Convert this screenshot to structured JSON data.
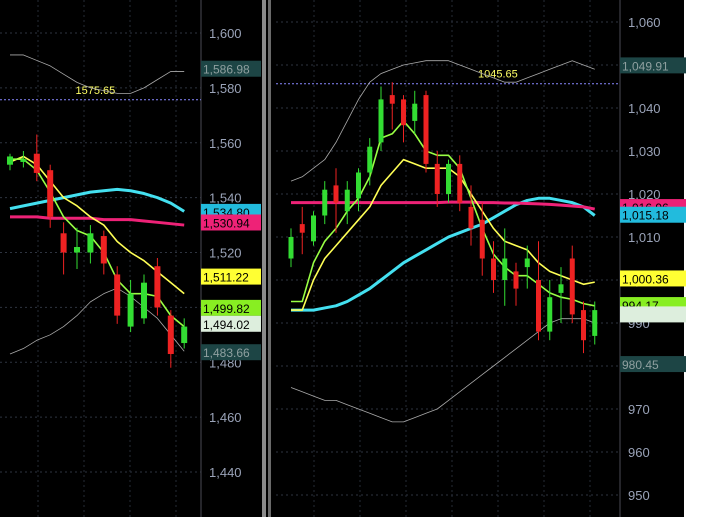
{
  "chart_data": [
    {
      "type": "candlestick",
      "panel": "left",
      "ylim": [
        1430,
        1615
      ],
      "yticks": [
        {
          "value": 1600,
          "label": "1,600"
        },
        {
          "value": 1580,
          "label": "1,580"
        },
        {
          "value": 1560,
          "label": "1,560"
        },
        {
          "value": 1540,
          "label": "1,540"
        },
        {
          "value": 1520,
          "label": "1,520"
        },
        {
          "value": 1500,
          "label": "1,500"
        },
        {
          "value": 1480,
          "label": "1,480"
        },
        {
          "value": 1460,
          "label": "1,460"
        },
        {
          "value": 1440,
          "label": "1,440"
        }
      ],
      "reference_line": {
        "value": 1575.65,
        "label": "1575.65"
      },
      "candles": [
        {
          "o": 1552,
          "h": 1556,
          "c": 1555,
          "l": 1550
        },
        {
          "o": 1553,
          "h": 1557,
          "c": 1554,
          "l": 1551
        },
        {
          "o": 1556,
          "h": 1563,
          "c": 1549,
          "l": 1546
        },
        {
          "o": 1550,
          "h": 1552,
          "c": 1533,
          "l": 1529
        },
        {
          "o": 1527,
          "h": 1531,
          "c": 1520,
          "l": 1512
        },
        {
          "o": 1520,
          "h": 1529,
          "c": 1522,
          "l": 1514
        },
        {
          "o": 1520,
          "h": 1530,
          "c": 1527,
          "l": 1516
        },
        {
          "o": 1526,
          "h": 1528,
          "c": 1516,
          "l": 1512
        },
        {
          "o": 1512,
          "h": 1515,
          "c": 1497,
          "l": 1494
        },
        {
          "o": 1493,
          "h": 1510,
          "c": 1505,
          "l": 1491
        },
        {
          "o": 1496,
          "h": 1512,
          "c": 1509,
          "l": 1494
        },
        {
          "o": 1515,
          "h": 1518,
          "c": 1500,
          "l": 1497
        },
        {
          "o": 1497,
          "h": 1499,
          "c": 1483,
          "l": 1478
        },
        {
          "o": 1487,
          "h": 1496,
          "c": 1493,
          "l": 1485
        }
      ],
      "series": [
        {
          "name": "",
          "color": "#44e0f0",
          "values": [
            1536,
            1537,
            1538,
            1539,
            1540,
            1541,
            1542,
            1542.5,
            1543,
            1542.5,
            1541.5,
            1540,
            1538,
            1535
          ]
        },
        {
          "name": "",
          "color": "#ee2277",
          "values": [
            1533,
            1533,
            1533,
            1532.5,
            1532.5,
            1532.5,
            1532.5,
            1532,
            1532,
            1532,
            1531.5,
            1531,
            1530.5,
            1530
          ]
        },
        {
          "name": "",
          "color": "#ffff55",
          "values": [
            1553,
            1555,
            1552,
            1546,
            1540,
            1537,
            1533,
            1530,
            1524,
            1520,
            1517,
            1513,
            1509,
            1505
          ]
        },
        {
          "name": "",
          "color": "#99ff44",
          "values": [
            1554,
            1554,
            1550,
            1542,
            1533,
            1528,
            1526,
            1520,
            1510,
            1505,
            1505,
            1504,
            1497,
            1493
          ]
        },
        {
          "name": "",
          "color": "#aaaaaa",
          "values": [
            1483,
            1485,
            1488,
            1490,
            1493,
            1497,
            1502,
            1505,
            1507,
            1504,
            1500,
            1496,
            1490,
            1484
          ]
        },
        {
          "name": "",
          "color": "#aaaaaa",
          "values": [
            1592,
            1592,
            1590,
            1588,
            1585,
            1582,
            1580,
            1579,
            1578,
            1578,
            1580,
            1583,
            1586,
            1586
          ]
        }
      ],
      "price_labels": [
        {
          "value": 1586.98,
          "label": "1,586.98",
          "bg": "#1d4545",
          "fg": "#8fa0a0"
        },
        {
          "value": 1534.8,
          "label": "1,534.80",
          "bg": "#22bbdd",
          "fg": "#000000"
        },
        {
          "value": 1530.94,
          "label": "1,530.94",
          "bg": "#ee2277",
          "fg": "#000000"
        },
        {
          "value": 1511.22,
          "label": "1,511.22",
          "bg": "#ffff33",
          "fg": "#000000"
        },
        {
          "value": 1499.82,
          "label": "1,499.82",
          "bg": "#88ee22",
          "fg": "#000000"
        },
        {
          "value": 1494.02,
          "label": "1,494.02",
          "bg": "#ddeedd",
          "fg": "#000000"
        },
        {
          "value": 1483.66,
          "label": "1,483.66",
          "bg": "#1d4545",
          "fg": "#8fa0a0"
        }
      ]
    },
    {
      "type": "candlestick",
      "panel": "right",
      "ylim": [
        945,
        1063
      ],
      "yticks": [
        {
          "value": 1060,
          "label": "1,060"
        },
        {
          "value": 1050,
          "label": "1,050"
        },
        {
          "value": 1040,
          "label": "1,040"
        },
        {
          "value": 1030,
          "label": "1,030"
        },
        {
          "value": 1020,
          "label": "1,020"
        },
        {
          "value": 1010,
          "label": "1,010"
        },
        {
          "value": 1000,
          "label": "1,000"
        },
        {
          "value": 990,
          "label": "990"
        },
        {
          "value": 980,
          "label": "980"
        },
        {
          "value": 970,
          "label": "970"
        },
        {
          "value": 960,
          "label": "960"
        },
        {
          "value": 950,
          "label": "950"
        }
      ],
      "reference_line": {
        "value": 1045.65,
        "label": "1045.65"
      },
      "candles": [
        {
          "o": 1005,
          "h": 1012,
          "c": 1010,
          "l": 1003
        },
        {
          "o": 1013,
          "h": 1017,
          "c": 1011,
          "l": 1006
        },
        {
          "o": 1009,
          "h": 1016,
          "c": 1015,
          "l": 1008
        },
        {
          "o": 1015,
          "h": 1023,
          "c": 1021,
          "l": 1013
        },
        {
          "o": 1022,
          "h": 1026,
          "c": 1018,
          "l": 1011
        },
        {
          "o": 1016,
          "h": 1023,
          "c": 1021,
          "l": 1013
        },
        {
          "o": 1019,
          "h": 1026,
          "c": 1025,
          "l": 1016
        },
        {
          "o": 1025,
          "h": 1033,
          "c": 1031,
          "l": 1022
        },
        {
          "o": 1032,
          "h": 1045,
          "c": 1042,
          "l": 1030
        },
        {
          "o": 1043,
          "h": 1046,
          "c": 1041,
          "l": 1035
        },
        {
          "o": 1042,
          "h": 1043,
          "c": 1036,
          "l": 1032
        },
        {
          "o": 1037,
          "h": 1044,
          "c": 1041,
          "l": 1034
        },
        {
          "o": 1043,
          "h": 1044,
          "c": 1027,
          "l": 1025
        },
        {
          "o": 1027,
          "h": 1030,
          "c": 1020,
          "l": 1017
        },
        {
          "o": 1020,
          "h": 1028,
          "c": 1027,
          "l": 1018
        },
        {
          "o": 1027,
          "h": 1029,
          "c": 1018,
          "l": 1016
        },
        {
          "o": 1017,
          "h": 1022,
          "c": 1012,
          "l": 1008
        },
        {
          "o": 1014,
          "h": 1018,
          "c": 1005,
          "l": 1001
        },
        {
          "o": 1005,
          "h": 1009,
          "c": 1000,
          "l": 997
        },
        {
          "o": 1000,
          "h": 1012,
          "c": 1005,
          "l": 994
        },
        {
          "o": 1002,
          "h": 1004,
          "c": 998,
          "l": 994
        },
        {
          "o": 1003,
          "h": 1008,
          "c": 1005,
          "l": 998
        },
        {
          "o": 1000,
          "h": 1009,
          "c": 988,
          "l": 986
        },
        {
          "o": 988,
          "h": 1000,
          "c": 996,
          "l": 986
        },
        {
          "o": 997,
          "h": 1003,
          "c": 999,
          "l": 990
        },
        {
          "o": 1005,
          "h": 1008,
          "c": 992,
          "l": 990
        },
        {
          "o": 993,
          "h": 995,
          "c": 986,
          "l": 983
        },
        {
          "o": 987,
          "h": 995,
          "c": 993,
          "l": 985
        }
      ],
      "series": [
        {
          "name": "",
          "color": "#44e0f0",
          "values": [
            993,
            993,
            993,
            993.5,
            994,
            995,
            996.5,
            998,
            1000,
            1002,
            1004,
            1005.5,
            1007,
            1008.5,
            1010,
            1011,
            1012,
            1013,
            1014.5,
            1016,
            1017.5,
            1018.5,
            1019,
            1019,
            1018.5,
            1018,
            1017,
            1015
          ]
        },
        {
          "name": "",
          "color": "#ee2277",
          "values": [
            1018,
            1018,
            1018,
            1018,
            1018,
            1018,
            1018,
            1018,
            1018,
            1018,
            1018,
            1018,
            1018,
            1018,
            1018.1,
            1018.1,
            1018.1,
            1018,
            1018,
            1017.9,
            1017.9,
            1017.8,
            1017.7,
            1017.6,
            1017.4,
            1017.2,
            1017,
            1016.5
          ]
        },
        {
          "name": "",
          "color": "#ffff55",
          "values": [
            993,
            993,
            1000,
            1005,
            1008,
            1011,
            1014,
            1017,
            1022,
            1025,
            1028,
            1027,
            1026,
            1026,
            1026,
            1024,
            1020,
            1016,
            1012,
            1009,
            1008,
            1007,
            1004,
            1002,
            1001,
            1000,
            999,
            999.5
          ]
        },
        {
          "name": "",
          "color": "#99ff44",
          "values": [
            995,
            995,
            1004,
            1009,
            1012,
            1016,
            1019,
            1024,
            1033,
            1034,
            1037,
            1034,
            1030,
            1029,
            1029,
            1026,
            1019,
            1012,
            1006,
            1003,
            1001,
            1001,
            999,
            997,
            996,
            995.5,
            994.5,
            994
          ]
        },
        {
          "name": "",
          "color": "#aaaaaa",
          "values": [
            975,
            974,
            973,
            972,
            972,
            971,
            970,
            969,
            968,
            967,
            967,
            968,
            969,
            970,
            972,
            974,
            976,
            978,
            980,
            982,
            984,
            986,
            988,
            990,
            991,
            991,
            991,
            990
          ]
        },
        {
          "name": "",
          "color": "#aaaaaa",
          "values": [
            1023,
            1024,
            1026,
            1028,
            1032,
            1037,
            1042,
            1046,
            1048,
            1049,
            1050,
            1050.5,
            1051,
            1051,
            1051,
            1050,
            1049,
            1048,
            1047,
            1046,
            1046,
            1047,
            1048,
            1049,
            1050,
            1051,
            1050,
            1049
          ]
        }
      ],
      "price_labels": [
        {
          "value": 1049.91,
          "label": "1,049.91",
          "bg": "#1d4545",
          "fg": "#8fa0a0"
        },
        {
          "value": 1016.96,
          "label": "1,016.96",
          "bg": "#ee2277",
          "fg": "#000000"
        },
        {
          "value": 1015.18,
          "label": "1,015.18",
          "bg": "#22bbdd",
          "fg": "#000000"
        },
        {
          "value": 1000.36,
          "label": "1,000.36",
          "bg": "#ffff33",
          "fg": "#000000"
        },
        {
          "value": 994.17,
          "label": "994.17",
          "bg": "#88ee22",
          "fg": "#000000"
        },
        {
          "value": 992.0,
          "label": "",
          "bg": "#ddeedd",
          "fg": "#000000"
        },
        {
          "value": 980.45,
          "label": "980.45",
          "bg": "#1d4545",
          "fg": "#8fa0a0"
        }
      ]
    }
  ]
}
